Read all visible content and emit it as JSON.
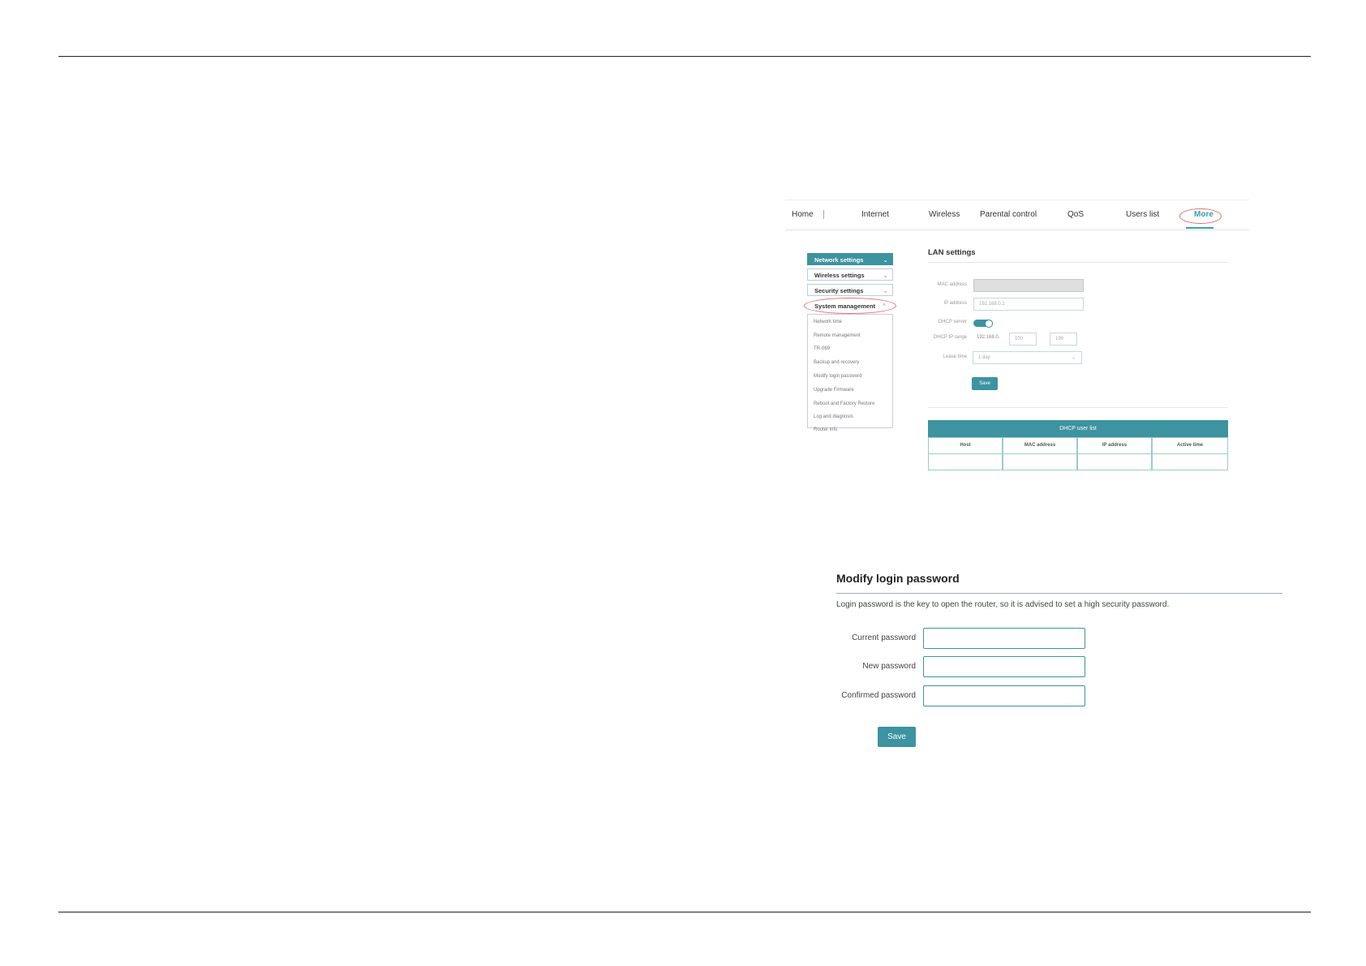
{
  "router_ui": {
    "nav": [
      "Home",
      "Internet",
      "Wireless",
      "Parental control",
      "QoS",
      "Users list",
      "More"
    ],
    "sidebar": [
      {
        "label": "Network settings",
        "chevron": "chevron-down-icon"
      },
      {
        "label": "Wireless settings",
        "chevron": "chevron-down-icon"
      },
      {
        "label": "Security settings",
        "chevron": "chevron-down-icon"
      },
      {
        "label": "System management",
        "chevron": "chevron-up-icon"
      }
    ],
    "submenu": [
      "Network time",
      "Remote management",
      "TR-069",
      "Backup and recovery",
      "Modify login password",
      "Upgrade Firmware",
      "Reboot and Factory Restore",
      "Log and diagnosis",
      "Router info"
    ],
    "lan": {
      "title": "LAN settings",
      "mac_label": "MAC address",
      "ip_label": "IP address",
      "ip_value": "192.168.0.1",
      "dhcp_label": "DHCP server",
      "range_label": "DHCP IP range",
      "range_prefix": "192.168.0.",
      "range_start": "100",
      "range_end": "199",
      "lease_label": "Lease time",
      "lease_value": "1 day",
      "save": "Save"
    },
    "dhcp_table": {
      "title": "DHCP user list",
      "columns": [
        "Host",
        "MAC address",
        "IP address",
        "Active time"
      ]
    }
  },
  "modify_password": {
    "title": "Modify login password",
    "description": "Login password is the key to open the router, so it is advised to set a high security password.",
    "fields": [
      "Current password",
      "New password",
      "Confirmed password"
    ],
    "save": "Save"
  },
  "colors": {
    "accent": "#3d93a0",
    "highlight_circle": "#e07070"
  }
}
